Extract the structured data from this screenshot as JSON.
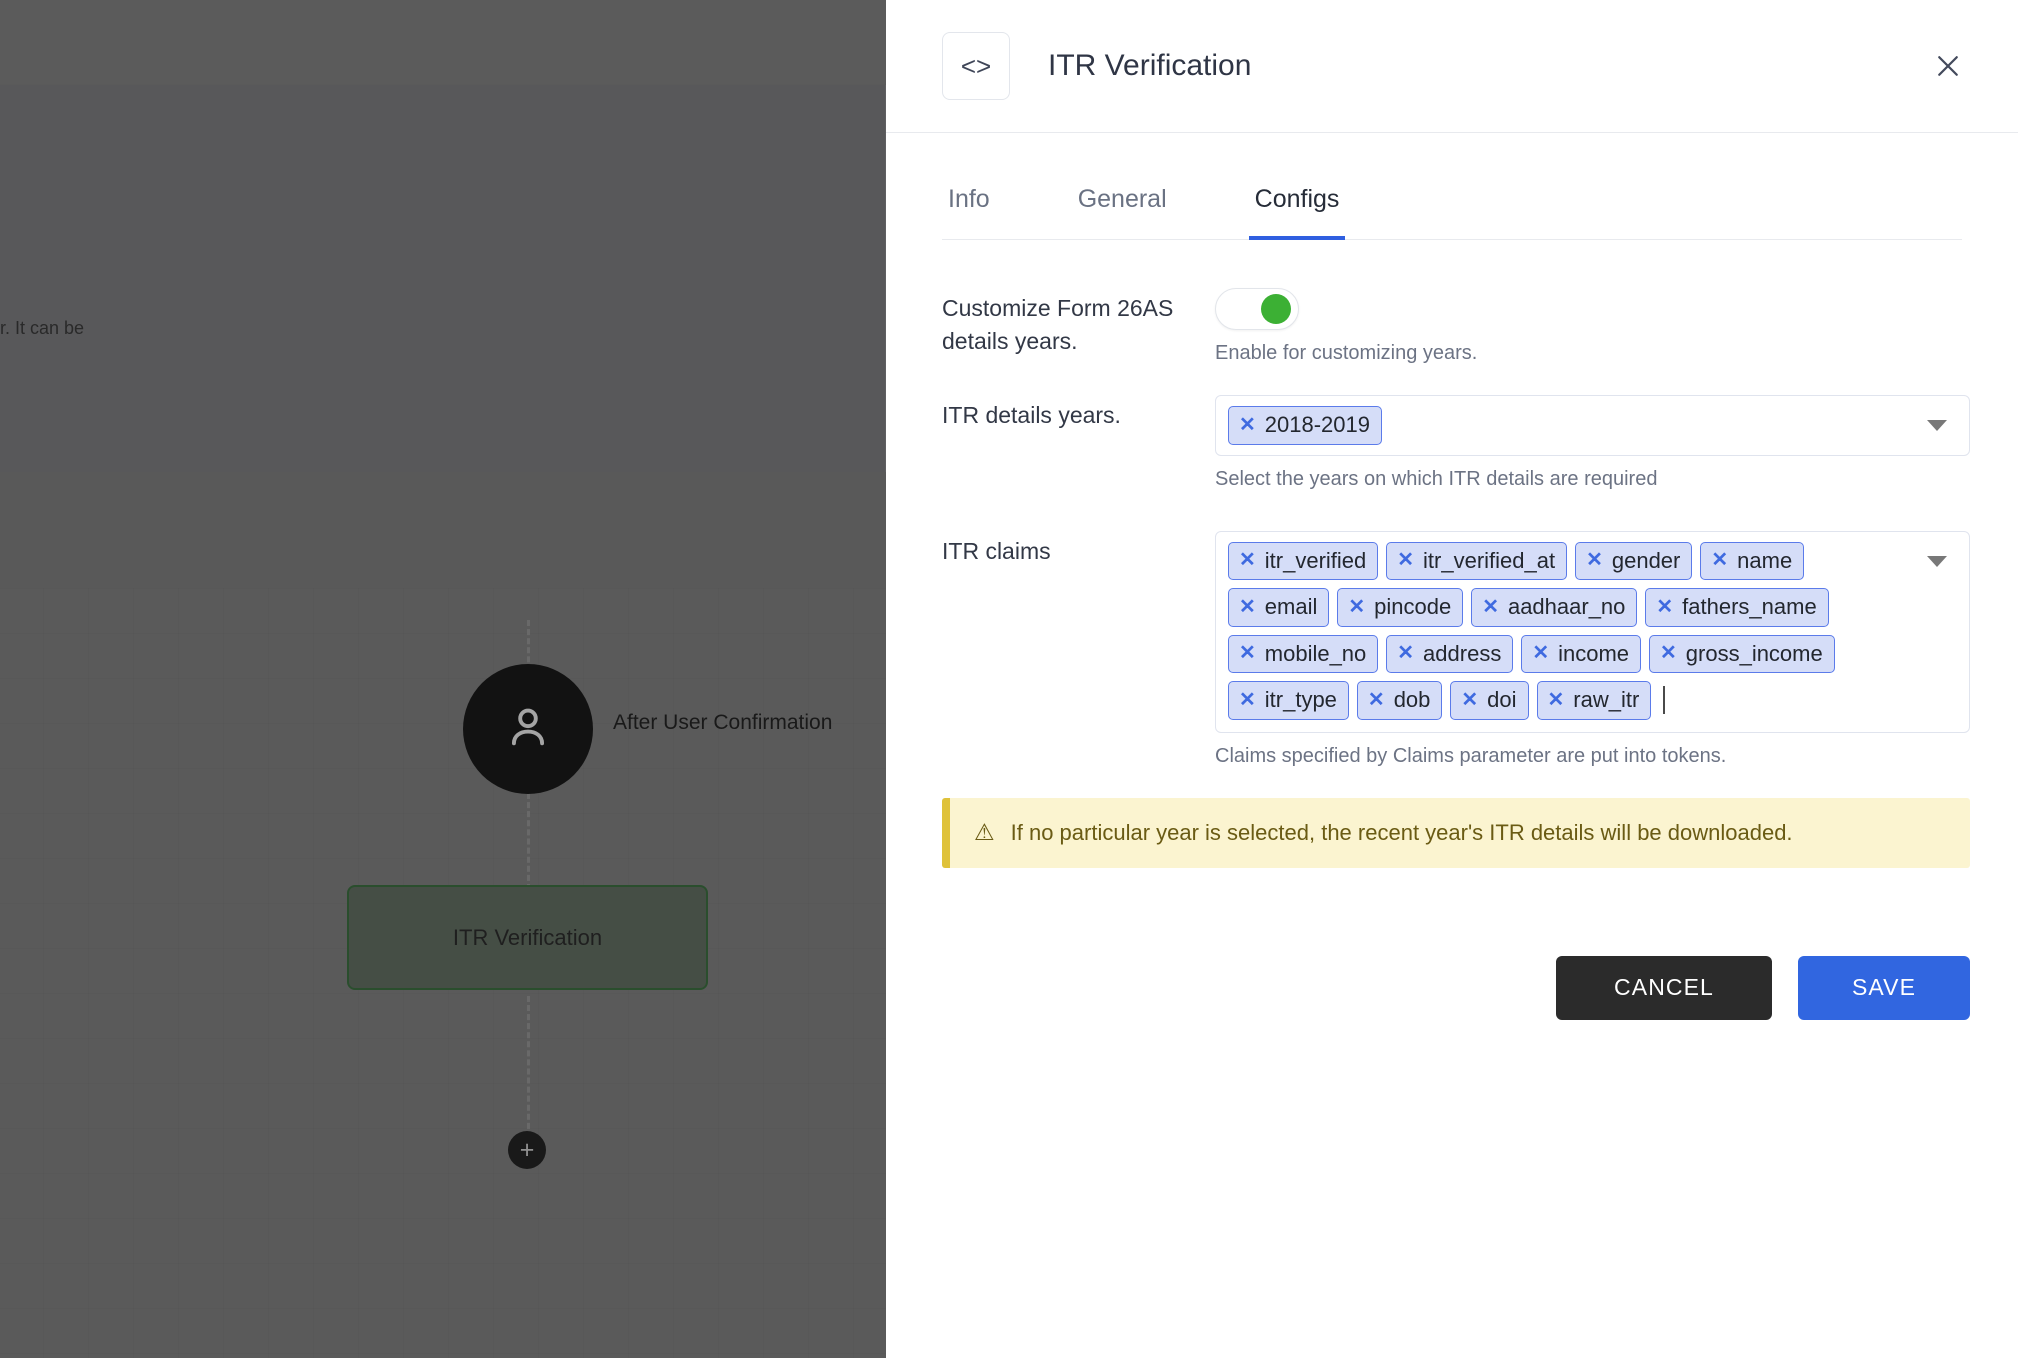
{
  "background": {
    "panel_text_fragment": "er. It can be",
    "user_node_label": "After User Confirmation",
    "itr_node_label": "ITR Verification",
    "add_node_icon": "+",
    "user_icon": "person-icon"
  },
  "drawer": {
    "header": {
      "code_icon": "<>",
      "title": "ITR Verification",
      "close_icon": "close-icon"
    },
    "tabs": [
      {
        "label": "Info",
        "active": false
      },
      {
        "label": "General",
        "active": false
      },
      {
        "label": "Configs",
        "active": true
      }
    ],
    "customize_form": {
      "label": "Customize Form 26AS details years.",
      "toggle_state": "on",
      "hint": "Enable for customizing years."
    },
    "itr_details_years": {
      "label": "ITR details years.",
      "chips": [
        "2018-2019"
      ],
      "hint": "Select the years on which ITR details are required"
    },
    "itr_claims": {
      "label": "ITR claims",
      "chips": [
        "itr_verified",
        "itr_verified_at",
        "gender",
        "name",
        "email",
        "pincode",
        "aadhaar_no",
        "fathers_name",
        "mobile_no",
        "address",
        "income",
        "gross_income",
        "itr_type",
        "dob",
        "doi",
        "raw_itr"
      ],
      "hint": "Claims specified by Claims parameter are put into tokens."
    },
    "warning": {
      "icon": "warning-triangle-icon",
      "text": "If no particular year is selected, the recent year's ITR details will be downloaded."
    },
    "actions": {
      "cancel_label": "CANCEL",
      "save_label": "SAVE"
    }
  },
  "colors": {
    "accent_blue": "#3166e0",
    "toggle_green": "#3cb034",
    "warning_bg": "#fbf4d0",
    "warning_border": "#dfc23a",
    "chip_bg": "#d5ddf8",
    "chip_border": "#5b7bea",
    "cancel_bg": "#2b2b2b"
  }
}
